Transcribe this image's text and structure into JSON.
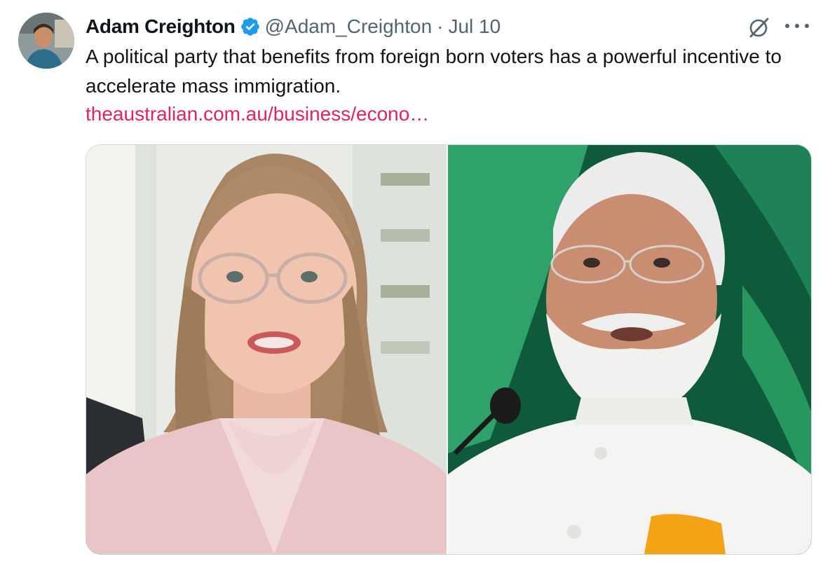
{
  "tweet": {
    "author_name": "Adam Creighton",
    "handle": "@Adam_Creighton",
    "separator": "·",
    "date": "Jul 10",
    "text": "A political party that benefits from foreign born voters has a powerful incentive to accelerate mass immigration.",
    "link_text": "theaustralian.com.au/business/econo…",
    "verified": true
  },
  "icons": {
    "verified": "verified-badge-icon",
    "grok": "grok-icon",
    "more": "more-options-icon"
  },
  "colors": {
    "link": "#e0245e",
    "secondary_text": "#536471",
    "verified": "#1d9bf0"
  }
}
